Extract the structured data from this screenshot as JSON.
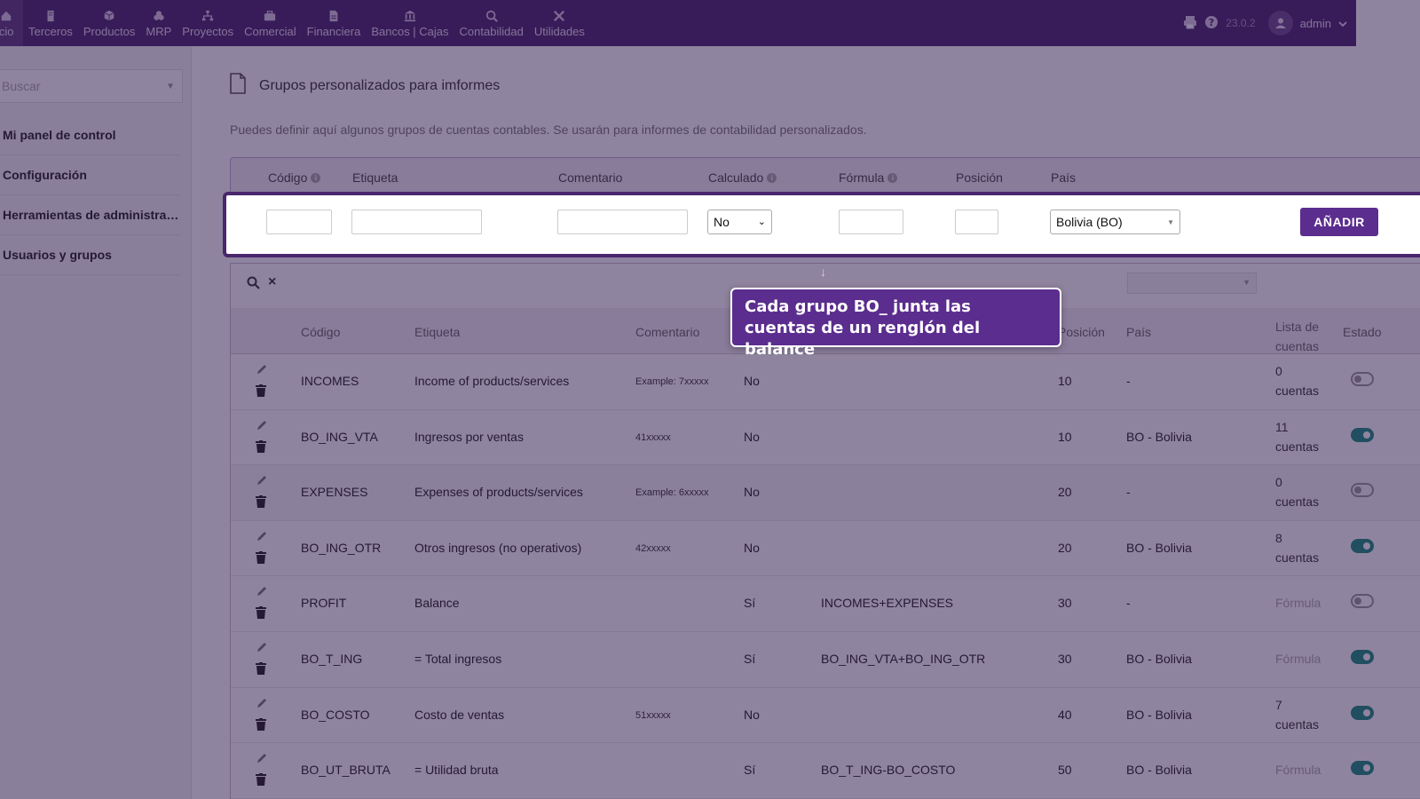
{
  "topbar": {
    "tabs": [
      {
        "label": "icio",
        "icon": "home-icon"
      },
      {
        "label": "Terceros",
        "icon": "building-icon"
      },
      {
        "label": "Productos",
        "icon": "cube-icon"
      },
      {
        "label": "MRP",
        "icon": "cubes-icon"
      },
      {
        "label": "Proyectos",
        "icon": "sitemap-icon"
      },
      {
        "label": "Comercial",
        "icon": "briefcase-icon"
      },
      {
        "label": "Financiera",
        "icon": "file-invoice-icon"
      },
      {
        "label": "Bancos | Cajas",
        "icon": "bank-icon"
      },
      {
        "label": "Contabilidad",
        "icon": "search-dollar-icon"
      },
      {
        "label": "Utilidades",
        "icon": "tools-icon"
      }
    ],
    "version": "23.0.2",
    "user": "admin"
  },
  "sidebar": {
    "search_placeholder": "Buscar",
    "items": [
      {
        "label": "Mi panel de control"
      },
      {
        "label": "Configuración"
      },
      {
        "label": "Herramientas de administración"
      },
      {
        "label": "Usuarios y grupos"
      }
    ]
  },
  "page": {
    "title": "Grupos personalizados para imformes",
    "description": "Puedes definir aquí algunos grupos de cuentas contables. Se usarán para informes de contabilidad personalizados."
  },
  "addform": {
    "headers": {
      "codigo": "Código",
      "etiqueta": "Etiqueta",
      "comentario": "Comentario",
      "calculado": "Calculado",
      "formula": "Fórmula",
      "posicion": "Posición",
      "pais": "País"
    },
    "calculado_value": "No",
    "pais_value": "Bolivia (BO)",
    "add_label": "AÑADIR"
  },
  "list": {
    "headers": {
      "codigo": "Código",
      "etiqueta": "Etiqueta",
      "comentario": "Comentario",
      "posicion": "Posición",
      "pais": "País",
      "lista1": "Lista de",
      "lista2": "cuentas",
      "estado": "Estado"
    },
    "rows": [
      {
        "code": "INCOMES",
        "label": "Income of products/services",
        "comment": "Example: 7xxxxx",
        "calc": "No",
        "formula": "",
        "pos": "10",
        "country": "-",
        "accounts1": "0",
        "accounts2": "cuentas",
        "status": "off"
      },
      {
        "code": "BO_ING_VTA",
        "label": "Ingresos por ventas",
        "comment": "41xxxxx",
        "calc": "No",
        "formula": "",
        "pos": "10",
        "country": "BO - Bolivia",
        "accounts1": "11",
        "accounts2": "cuentas",
        "status": "on"
      },
      {
        "code": "EXPENSES",
        "label": "Expenses of products/services",
        "comment": "Example: 6xxxxx",
        "calc": "No",
        "formula": "",
        "pos": "20",
        "country": "-",
        "accounts1": "0",
        "accounts2": "cuentas",
        "status": "off"
      },
      {
        "code": "BO_ING_OTR",
        "label": "Otros ingresos (no operativos)",
        "comment": "42xxxxx",
        "calc": "No",
        "formula": "",
        "pos": "20",
        "country": "BO - Bolivia",
        "accounts1": "8",
        "accounts2": "cuentas",
        "status": "on"
      },
      {
        "code": "PROFIT",
        "label": "Balance",
        "comment": "",
        "calc": "Sí",
        "formula": "INCOMES+EXPENSES",
        "pos": "30",
        "country": "-",
        "accounts1": "Fórmula",
        "accounts2": "",
        "status": "off"
      },
      {
        "code": "BO_T_ING",
        "label": "= Total ingresos",
        "comment": "",
        "calc": "Sí",
        "formula": "BO_ING_VTA+BO_ING_OTR",
        "pos": "30",
        "country": "BO - Bolivia",
        "accounts1": "Fórmula",
        "accounts2": "",
        "status": "on"
      },
      {
        "code": "BO_COSTO",
        "label": "Costo de ventas",
        "comment": "51xxxxx",
        "calc": "No",
        "formula": "",
        "pos": "40",
        "country": "BO - Bolivia",
        "accounts1": "7",
        "accounts2": "cuentas",
        "status": "on"
      },
      {
        "code": "BO_UT_BRUTA",
        "label": "= Utilidad bruta",
        "comment": "",
        "calc": "Sí",
        "formula": "BO_T_ING-BO_COSTO",
        "pos": "50",
        "country": "BO - Bolivia",
        "accounts1": "Fórmula",
        "accounts2": "",
        "status": "on"
      }
    ]
  },
  "callout": {
    "text": "Cada grupo BO_ junta las cuentas de un renglón del balance"
  }
}
